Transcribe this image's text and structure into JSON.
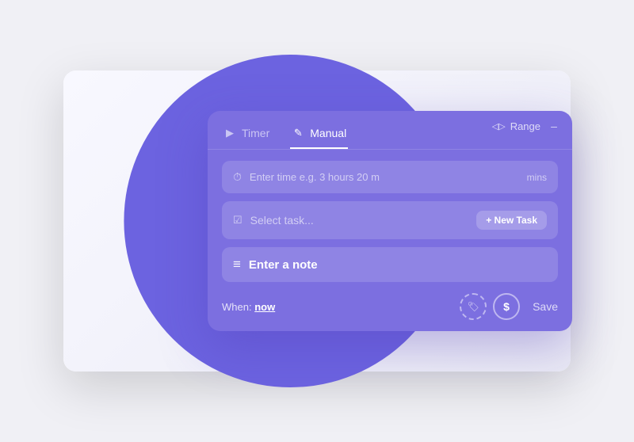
{
  "background": {
    "color": "#f0f0f5"
  },
  "tabs": [
    {
      "id": "timer",
      "label": "Timer",
      "active": false,
      "icon": "timer-icon"
    },
    {
      "id": "manual",
      "label": "Manual",
      "active": true,
      "icon": "edit-icon"
    }
  ],
  "range_label": "Range",
  "minimize_label": "–",
  "time_input": {
    "placeholder": "Enter time e.g. 3 hours 20 m",
    "mins_label": "mins"
  },
  "task_input": {
    "placeholder": "Select task..."
  },
  "new_task_button": "+ New Task",
  "note_input": {
    "placeholder": "Enter a note"
  },
  "when": {
    "label": "When:",
    "value": "now"
  },
  "actions": {
    "tag_icon": "🏷",
    "dollar_icon": "$",
    "save_label": "Save"
  }
}
